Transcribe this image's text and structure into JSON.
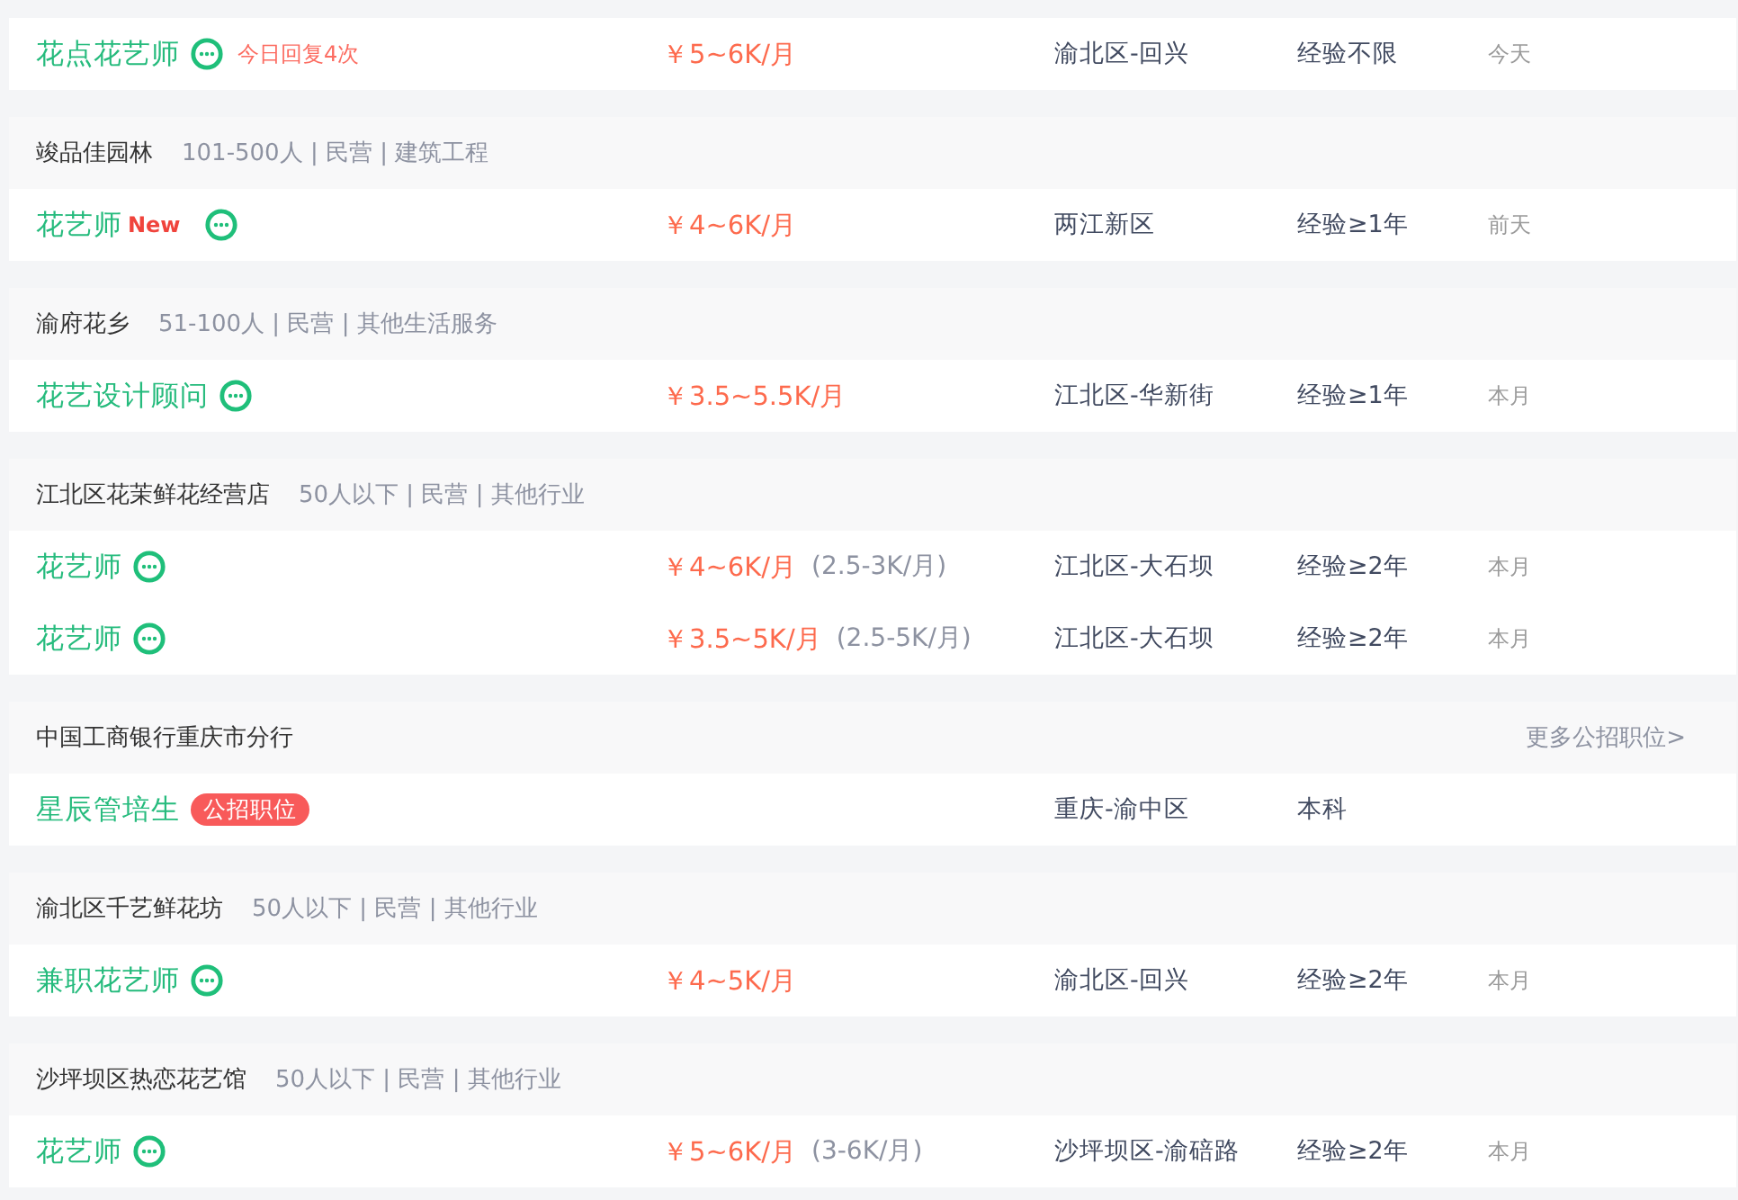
{
  "groups": [
    {
      "jobs": [
        {
          "title": "花点花艺师",
          "marks": [
            {
              "kind": "chat"
            },
            {
              "kind": "reply",
              "text": "今日回复4次"
            }
          ],
          "salary": "￥5~6K/月",
          "location": "渝北区-回兴",
          "experience": "经验不限",
          "date": "今天"
        }
      ]
    },
    {
      "company": {
        "name": "竣品佳园林",
        "info": "101-500人 | 民营 | 建筑工程"
      },
      "jobs": [
        {
          "title": "花艺师",
          "marks": [
            {
              "kind": "new",
              "text": "New"
            },
            {
              "kind": "chat"
            }
          ],
          "salary": "￥4~6K/月",
          "location": "两江新区",
          "experience": "经验≥1年",
          "date": "前天"
        }
      ]
    },
    {
      "company": {
        "name": "渝府花乡",
        "info": "51-100人 | 民营 | 其他生活服务"
      },
      "jobs": [
        {
          "title": "花艺设计顾问",
          "marks": [
            {
              "kind": "chat"
            }
          ],
          "salary": "￥3.5~5.5K/月",
          "location": "江北区-华新街",
          "experience": "经验≥1年",
          "date": "本月"
        }
      ]
    },
    {
      "company": {
        "name": "江北区花茉鲜花经营店",
        "info": "50人以下 | 民营 | 其他行业"
      },
      "jobs": [
        {
          "title": "花艺师",
          "marks": [
            {
              "kind": "chat"
            }
          ],
          "salary": "￥4~6K/月",
          "salary_extra": "(2.5-3K/月)",
          "location": "江北区-大石坝",
          "experience": "经验≥2年",
          "date": "本月"
        },
        {
          "title": "花艺师",
          "marks": [
            {
              "kind": "chat"
            }
          ],
          "salary": "￥3.5~5K/月",
          "salary_extra": "(2.5-5K/月)",
          "location": "江北区-大石坝",
          "experience": "经验≥2年",
          "date": "本月"
        }
      ]
    },
    {
      "company": {
        "name": "中国工商银行重庆市分行",
        "link": "更多公招职位>"
      },
      "jobs": [
        {
          "title": "星辰管培生",
          "marks": [
            {
              "kind": "public",
              "text": "公招职位"
            }
          ],
          "location": "重庆-渝中区",
          "experience": "本科"
        }
      ]
    },
    {
      "company": {
        "name": "渝北区千艺鲜花坊",
        "info": "50人以下 | 民营 | 其他行业"
      },
      "jobs": [
        {
          "title": "兼职花艺师",
          "marks": [
            {
              "kind": "chat"
            }
          ],
          "salary": "￥4~5K/月",
          "location": "渝北区-回兴",
          "experience": "经验≥2年",
          "date": "本月"
        }
      ]
    },
    {
      "company": {
        "name": "沙坪坝区热恋花艺馆",
        "info": "50人以下 | 民营 | 其他行业"
      },
      "jobs": [
        {
          "title": "花艺师",
          "marks": [
            {
              "kind": "chat"
            }
          ],
          "salary": "￥5~6K/月",
          "salary_extra": "(3-6K/月)",
          "location": "沙坪坝区-渝碚路",
          "experience": "经验≥2年",
          "date": "本月"
        }
      ]
    }
  ]
}
